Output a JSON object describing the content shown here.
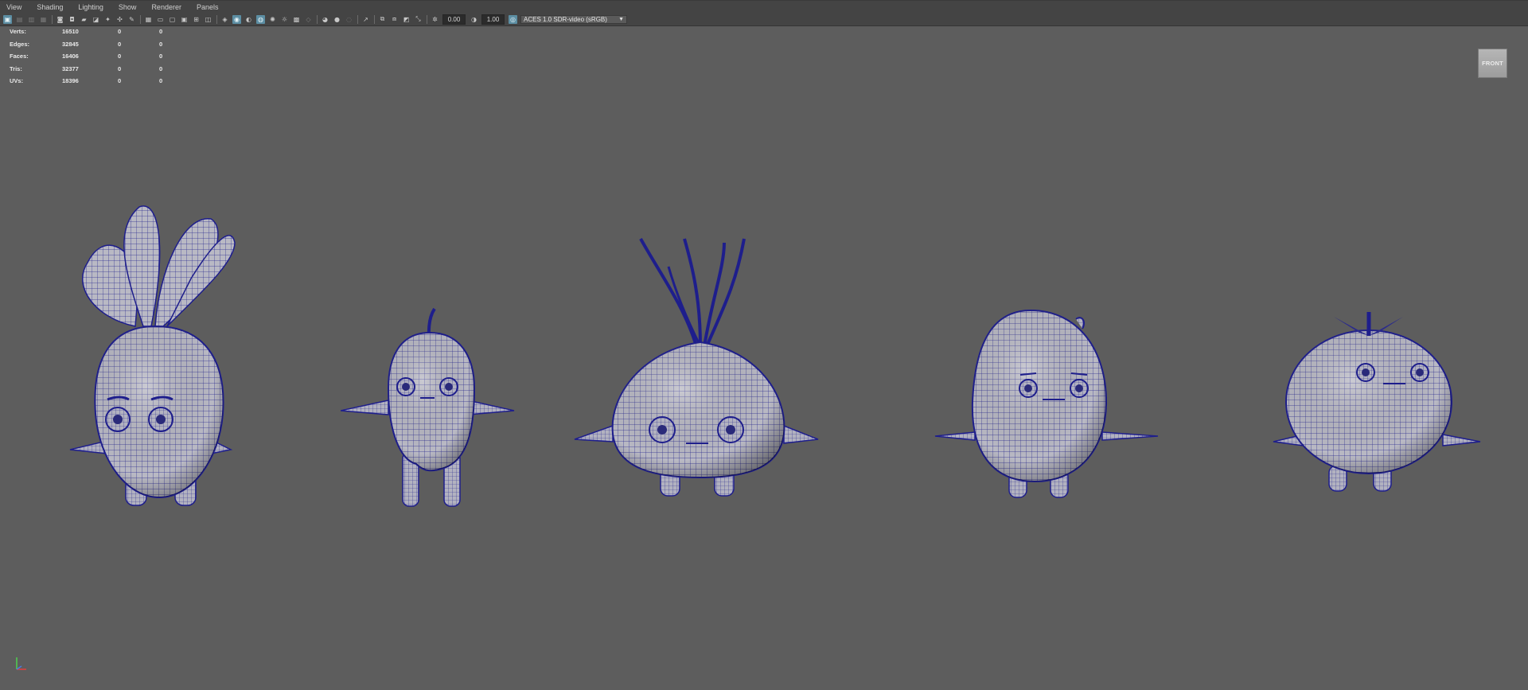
{
  "menubar": {
    "items": [
      "View",
      "Shading",
      "Lighting",
      "Show",
      "Renderer",
      "Panels"
    ]
  },
  "toolbar": {
    "exposure_value": "0.00",
    "gamma_value": "1.00",
    "color_space": "ACES 1.0 SDR-video (sRGB)",
    "icons": [
      "select-camera-icon",
      "lock-camera-icon",
      "camera-attributes-icon",
      "bookmark-icon",
      "image-plane-icon",
      "grid-icon",
      "film-gate-icon",
      "resolution-gate-icon",
      "gate-mask-icon",
      "field-chart-icon",
      "safe-action-icon",
      "safe-title-icon",
      "wireframe-icon",
      "smooth-shade-icon",
      "default-material-icon",
      "textured-icon",
      "lights-icon",
      "shadows-icon",
      "ambient-occlusion-icon",
      "motion-blur-icon",
      "anti-aliasing-icon",
      "depth-of-field-icon",
      "isolate-select-icon",
      "xray-icon",
      "xray-joints-icon",
      "backface-culling-icon"
    ]
  },
  "hud": {
    "rows": [
      {
        "label": "Verts:",
        "v1": "16510",
        "v2": "0",
        "v3": "0"
      },
      {
        "label": "Edges:",
        "v1": "32845",
        "v2": "0",
        "v3": "0"
      },
      {
        "label": "Faces:",
        "v1": "16406",
        "v2": "0",
        "v3": "0"
      },
      {
        "label": "Tris:",
        "v1": "32377",
        "v2": "0",
        "v3": "0"
      },
      {
        "label": "UVs:",
        "v1": "18396",
        "v2": "0",
        "v3": "0"
      }
    ]
  },
  "viewcube": {
    "label": "FRONT"
  },
  "viewport": {
    "background_color": "#5d5d5d",
    "wire_color": "#1e1e8c",
    "mesh_color": "#b9b9c4"
  }
}
